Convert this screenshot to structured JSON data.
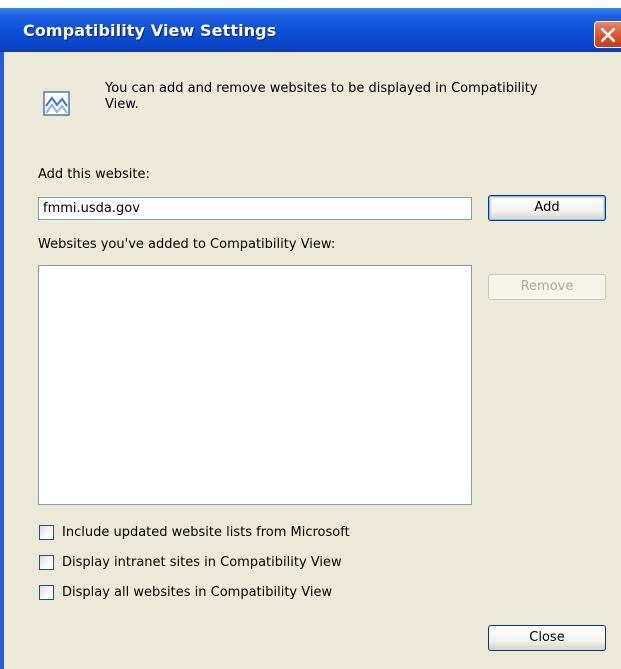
{
  "window": {
    "title": "Compatibility View Settings"
  },
  "info": {
    "text": "You can add and remove websites to be displayed in Compatibility View.",
    "icon": "compatibility-view-icon"
  },
  "add_section": {
    "label": "Add this website:",
    "input_value": "fmmi.usda.gov",
    "add_button": "Add"
  },
  "list_section": {
    "label": "Websites you've added to Compatibility View:",
    "items": [],
    "remove_button": "Remove"
  },
  "options": [
    {
      "label": "Include updated website lists from Microsoft",
      "checked": false
    },
    {
      "label": "Display intranet sites in Compatibility View",
      "checked": false
    },
    {
      "label": "Display all websites in Compatibility View",
      "checked": false
    }
  ],
  "footer": {
    "close_button": "Close"
  },
  "colors": {
    "titlebar": "#0a4fd6",
    "dialog_background": "#ece9d8",
    "close_button": "#d8542f"
  }
}
